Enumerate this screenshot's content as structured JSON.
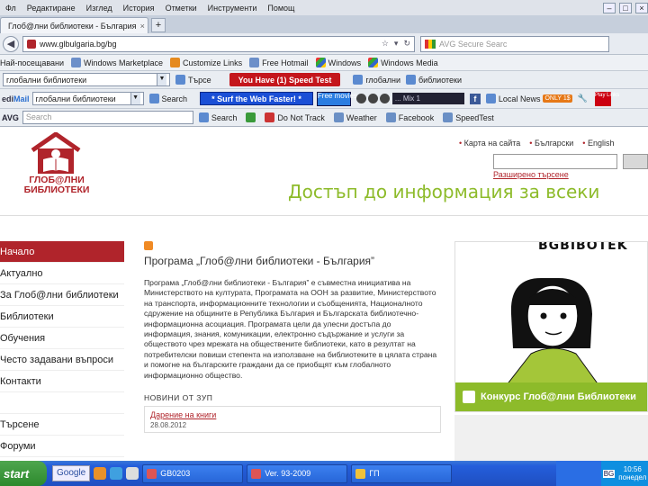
{
  "menubar": {
    "items": [
      "Фл",
      "Редактиране",
      "Изглед",
      "История",
      "Отметки",
      "Инструменти",
      "Помощ"
    ]
  },
  "tab": {
    "title": "Глоб@лни библиотеки - България"
  },
  "nav": {
    "url": "www.glbulgaria.bg/bg",
    "search_placeholder": "AVG Secure Searc"
  },
  "bookmarks": [
    {
      "label": "Най-посещавани"
    },
    {
      "label": "Windows Marketplace"
    },
    {
      "label": "Customize Links"
    },
    {
      "label": "Free Hotmail"
    },
    {
      "label": "Windows"
    },
    {
      "label": "Windows Media"
    }
  ],
  "toolbar1": {
    "combo1": "глобални библиотеки",
    "search_label": "Търсе",
    "alert_button": "You Have (1) Speed Test",
    "item1": "глобални",
    "item2": "библиотеки"
  },
  "toolbar2": {
    "brand_a": "edi",
    "brand_b": "Mail",
    "combo2": "глобални библиотеки",
    "search_label": "Search",
    "surf_button": "* Surf the Web Faster! *",
    "free_movies": "Free movies",
    "mix_label": "... Mix 1",
    "local_news": "Local News",
    "badge": "ONLY 1$",
    "play": "Play Links"
  },
  "toolbar3": {
    "brand": "AVG",
    "search_placeholder": "Search",
    "search_label": "Search",
    "items": [
      "",
      "Do Not Track",
      "",
      "Weather",
      "Facebook",
      "SpeedTest"
    ]
  },
  "page": {
    "logo_line1": "ГЛОБ@ЛНИ",
    "logo_line2": "БИБЛИОТЕКИ",
    "toplinks": [
      "Карта на сайта",
      "Български",
      "English"
    ],
    "advanced_search": "Разширено търсене",
    "tagline": "Достъп до информация за всеки",
    "nav": [
      "Начало",
      "Актуално",
      "За Глоб@лни библиотеки",
      "Библиотеки",
      "Обучения",
      "Често задавани въпроси",
      "Контакти",
      "",
      "Търсене",
      "Форуми"
    ],
    "program_title": "Програма „Глоб@лни библиотеки - България”",
    "body": "Програма „Глоб@лни библиотеки - България” е съвместна инициатива на Министерството на културата, Програмата на ООН за развитие, Министерството на транспорта, информационните технологии и съобщенията, Националното сдружение на общините в Република България и Българската библиотечно-информационна асоциация. Програмата цели да улесни достъпа до информация, знания, комуникации, електронно съдържание и услуги за обществото чрез мрежата на обществените библиотеки, като в резултат на потребителски повиши степента на използване на библиотеките в цялата страна и помогне на българските граждани да се приобщят към глобалното информационно общество.",
    "news_heading": "НОВИНИ ОТ ЗУП",
    "news_link": "Дарение на книги",
    "news_date": "28.08.2012",
    "banner_top": "BGBIBOTEK",
    "banner_caption": "Конкурс Глоб@лни Библиотеки"
  },
  "taskbar": {
    "start": "start",
    "google": "Google",
    "tasks": [
      "GB0203",
      "Ver. 93-2009",
      "ГП"
    ],
    "lang": "BG",
    "time": "10:56",
    "day": "понедел"
  }
}
